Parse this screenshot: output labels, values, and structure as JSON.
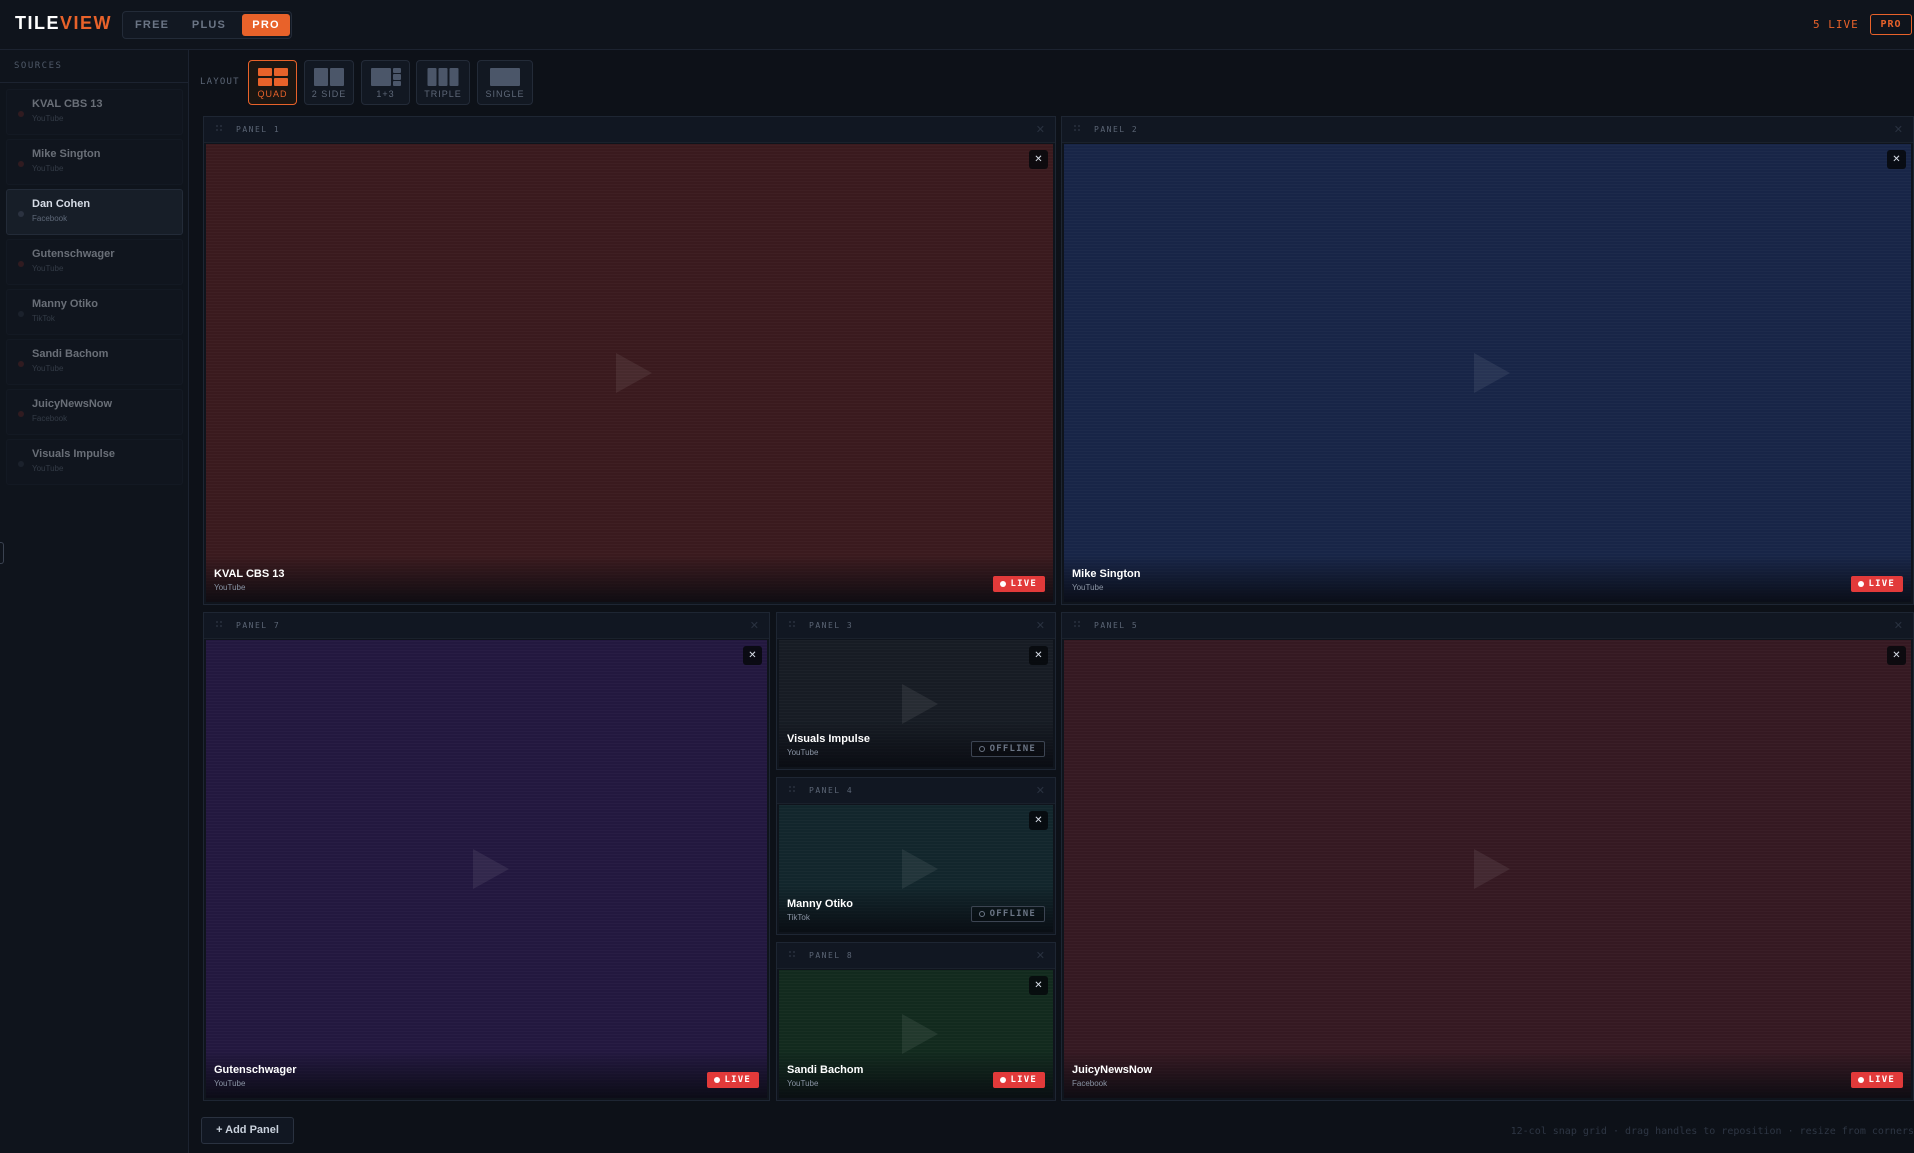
{
  "app": {
    "logo_part1": "TILE",
    "logo_part2": "VIEW",
    "tiers": [
      {
        "label": "FREE",
        "active": false
      },
      {
        "label": "PLUS",
        "active": false
      },
      {
        "label": "PRO",
        "active": true
      }
    ],
    "live_count": "5 LIVE",
    "plan_badge": "PRO",
    "accent_color": "#e8622a",
    "live_color": "#e23a3a"
  },
  "sidebar": {
    "title": "SOURCES",
    "sources": [
      {
        "name": "KVAL CBS 13",
        "platform": "YouTube",
        "live": true,
        "active": false
      },
      {
        "name": "Mike Sington",
        "platform": "YouTube",
        "live": true,
        "active": false
      },
      {
        "name": "Dan Cohen",
        "platform": "Facebook",
        "live": false,
        "active": true
      },
      {
        "name": "Gutenschwager",
        "platform": "YouTube",
        "live": true,
        "active": false
      },
      {
        "name": "Manny Otiko",
        "platform": "TikTok",
        "live": false,
        "active": false
      },
      {
        "name": "Sandi Bachom",
        "platform": "YouTube",
        "live": true,
        "active": false
      },
      {
        "name": "JuicyNewsNow",
        "platform": "Facebook",
        "live": true,
        "active": false
      },
      {
        "name": "Visuals Impulse",
        "platform": "YouTube",
        "live": false,
        "active": false
      }
    ]
  },
  "layout_bar": {
    "label": "LAYOUT",
    "options": [
      {
        "name": "QUAD",
        "icon": "quad-layout-icon",
        "active": true
      },
      {
        "name": "2 SIDE",
        "icon": "two-side-layout-icon",
        "active": false
      },
      {
        "name": "1+3",
        "icon": "one-plus-three-layout-icon",
        "active": false
      },
      {
        "name": "TRIPLE",
        "icon": "triple-layout-icon",
        "active": false
      },
      {
        "name": "SINGLE",
        "icon": "single-layout-icon",
        "active": false
      }
    ]
  },
  "panels": [
    {
      "title": "PANEL 1",
      "source": "KVAL CBS 13",
      "platform": "YouTube",
      "status": "LIVE",
      "tint": "#3a1a1e"
    },
    {
      "title": "PANEL 2",
      "source": "Mike Sington",
      "platform": "YouTube",
      "status": "LIVE",
      "tint": "#182547"
    },
    {
      "title": "PANEL 7",
      "source": "Gutenschwager",
      "platform": "YouTube",
      "status": "LIVE",
      "tint": "#23183f"
    },
    {
      "title": "PANEL 3",
      "source": "Visuals Impulse",
      "platform": "YouTube",
      "status": "OFFLINE",
      "tint": "#171c24"
    },
    {
      "title": "PANEL 4",
      "source": "Manny Otiko",
      "platform": "TikTok",
      "status": "OFFLINE",
      "tint": "#12262c"
    },
    {
      "title": "PANEL 8",
      "source": "Sandi Bachom",
      "platform": "YouTube",
      "status": "LIVE",
      "tint": "#122a1e"
    },
    {
      "title": "PANEL 5",
      "source": "JuicyNewsNow",
      "platform": "Facebook",
      "status": "LIVE",
      "tint": "#351922"
    }
  ],
  "footer": {
    "add_panel_label": "+ Add Panel",
    "hint": "12-col snap grid · drag handles to reposition · resize from corners"
  }
}
